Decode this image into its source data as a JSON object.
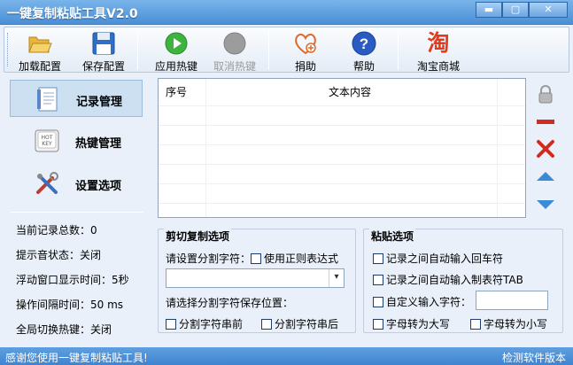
{
  "window": {
    "title": "一键复制粘贴工具V2.0"
  },
  "toolbar": {
    "load_config": "加载配置",
    "save_config": "保存配置",
    "apply_hotkey": "应用热键",
    "cancel_hotkey": "取消热键",
    "donate": "捐助",
    "help": "帮助",
    "taobao": "淘宝商城",
    "taobao_glyph": "淘"
  },
  "nav": {
    "records": "记录管理",
    "hotkeys": "热键管理",
    "settings": "设置选项",
    "hotkey_icon_text": "HOT KEY"
  },
  "stats": {
    "record_count": "当前记录总数：0",
    "sound": "提示音状态：关闭",
    "float_time": "浮动窗口显示时间：5秒",
    "interval": "操作间隔时间：50 ms",
    "global_hotkey": "全局切换热键：关闭"
  },
  "list": {
    "col_index": "序号",
    "col_text": "文本内容",
    "rows": []
  },
  "cut_group": {
    "title": "剪切复制选项",
    "sep_label": "请设置分割字符：",
    "use_regex": "使用正则表达式",
    "sep_value": "",
    "pos_label": "请选择分割字符保存位置：",
    "before": "分割字符串前",
    "after": "分割字符串后"
  },
  "paste_group": {
    "title": "粘贴选项",
    "auto_enter": "记录之间自动输入回车符",
    "auto_tab": "记录之间自动输入制表符TAB",
    "custom": "自定义输入字符：",
    "custom_value": "",
    "upper": "字母转为大写",
    "lower": "字母转为小写"
  },
  "status": {
    "left": "感谢您使用一键复制粘贴工具!",
    "right": "检测软件版本"
  },
  "colors": {
    "accent": "#4a8fd6",
    "status_bar": "#3f84cf"
  }
}
